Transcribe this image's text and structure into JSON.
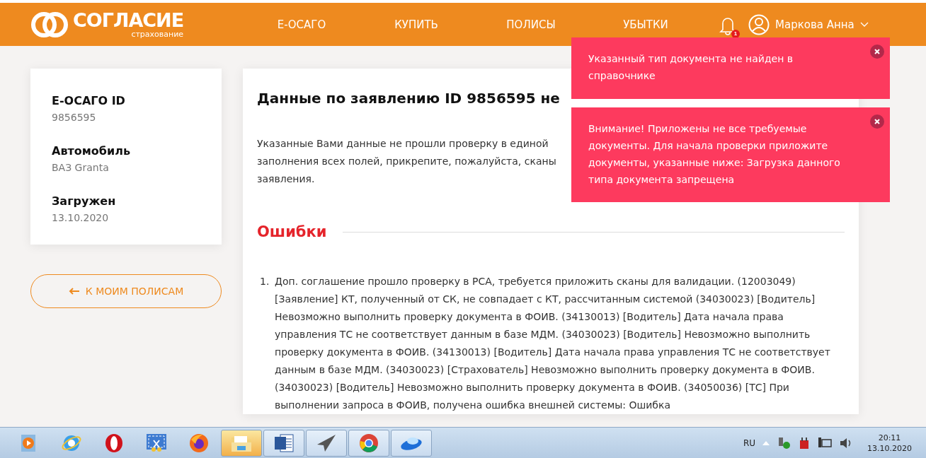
{
  "header": {
    "logo": {
      "name": "СОГЛАСИЕ",
      "tagline": "страхование"
    },
    "nav": [
      {
        "label": "Е-ОСАГО"
      },
      {
        "label": "КУПИТЬ"
      },
      {
        "label": "ПОЛИСЫ"
      },
      {
        "label": "УБЫТКИ"
      }
    ],
    "notifications": {
      "count": "1"
    },
    "user": {
      "name": "Маркова Анна"
    }
  },
  "summary": {
    "fields": [
      {
        "label": "Е-ОСАГО ID",
        "value": "9856595"
      },
      {
        "label": "Автомобиль",
        "value": "ВАЗ Granta"
      },
      {
        "label": "Загружен",
        "value": "13.10.2020"
      }
    ]
  },
  "back_button": {
    "label": "К МОИМ ПОЛИСАМ"
  },
  "main": {
    "title": "Данные по заявлению ID 9856595 не",
    "intro_lines": [
      "Указанные Вами данные не прошли проверку в единой",
      "заполнения всех полей, прикрепите, пожалуйста, сканы",
      "заявления."
    ],
    "errors": {
      "title": "Ошибки",
      "items": [
        {
          "number": "1.",
          "text": "Доп. соглашение прошло проверку в РСА, требуется приложить сканы для валидации. (12003049) [Заявление] КТ, полученный от СК, не совпадает с КТ, рассчитанным системой (34030023) [Водитель] Невозможно выполнить проверку документа в ФОИВ. (34130013) [Водитель] Дата начала права управления ТС не соответствует данным в базе МДМ. (34030023) [Водитель] Невозможно выполнить проверку документа в ФОИВ. (34130013) [Водитель] Дата начала права управления ТС не соответствует данным в базе МДМ. (34030023) [Страхователь] Невозможно выполнить проверку документа в ФОИВ. (34030023) [Водитель] Невозможно выполнить проверку документа в ФОИВ. (34050036) [ТС] При выполнении запроса в ФОИВ, получена ошибка внешней системы: Ошибка"
        }
      ]
    }
  },
  "toasts": [
    {
      "message": "Указанный тип документа не найден в справочнике"
    },
    {
      "message": "Внимание! Приложены не все требуемые документы. Для начала проверки приложите документы, указанные ниже: Загрузка данного типа документа запрещена"
    }
  ],
  "taskbar": {
    "apps": [
      {
        "kind": "media",
        "running": false,
        "selected": false
      },
      {
        "kind": "ie",
        "running": false,
        "selected": false
      },
      {
        "kind": "opera",
        "running": false,
        "selected": false
      },
      {
        "kind": "scissors",
        "running": false,
        "selected": false
      },
      {
        "kind": "firefox",
        "running": false,
        "selected": false
      },
      {
        "kind": "folder",
        "running": true,
        "selected": true
      },
      {
        "kind": "word",
        "running": true,
        "selected": false
      },
      {
        "kind": "plane",
        "running": true,
        "selected": false
      },
      {
        "kind": "chrome",
        "running": true,
        "selected": false
      },
      {
        "kind": "saucer",
        "running": true,
        "selected": false
      }
    ],
    "tray": {
      "language": "RU",
      "time": "20:11",
      "date": "13.10.2020"
    }
  }
}
